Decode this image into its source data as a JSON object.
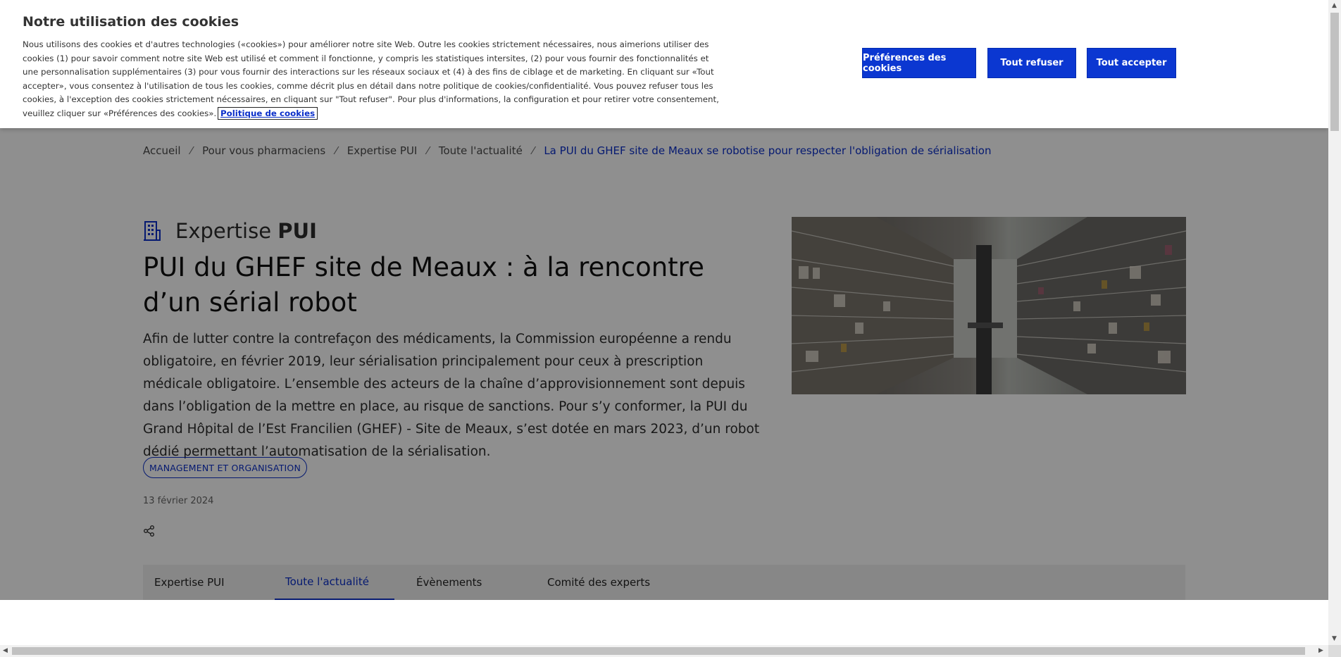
{
  "cookie": {
    "title": "Notre utilisation des cookies",
    "text": "Nous utilisons des cookies et d'autres technologies («cookies») pour améliorer notre site Web. Outre les cookies strictement nécessaires, nous aimerions utiliser des cookies (1) pour savoir comment notre site Web est utilisé et comment il fonctionne, y compris les statistiques intersites, (2) pour vous fournir des fonctionnalités et une personnalisation supplémentaires (3) pour vous fournir des interactions sur les réseaux sociaux et (4) à des fins de ciblage et de marketing. En cliquant sur «Tout accepter», vous consentez à l'utilisation de tous les cookies, comme décrit plus en détail dans notre politique de cookies/confidentialité. Vous pouvez refuser tous les cookies, à l'exception des cookies strictement nécessaires, en cliquant sur \"Tout refuser\". Pour plus d'informations, la configuration et pour retirer votre consentement, veuillez cliquer sur «Préférences des cookies».",
    "link": "Politique de cookies",
    "buttons": {
      "preferences": "Préférences des cookies",
      "refuse": "Tout refuser",
      "accept": "Tout accepter"
    }
  },
  "breadcrumb": {
    "items": [
      "Accueil",
      "Pour vous pharmaciens",
      "Expertise PUI",
      "Toute l'actualité"
    ],
    "current": "La PUI du GHEF site de Meaux se robotise pour respecter l'obligation de sérialisation",
    "separator": "⁄"
  },
  "article": {
    "section_prefix": "Expertise",
    "section_bold": "PUI",
    "section_icon": "building-icon",
    "title": "PUI du GHEF site de Meaux : à la rencontre d’un sérial robot",
    "lead": "Afin de lutter contre la contrefaçon des médicaments, la Commission européenne a rendu obligatoire, en février 2019, leur sérialisation principalement pour ceux à prescription médicale obligatoire. L’ensemble des acteurs de la chaîne d’approvisionnement sont depuis dans l’obligation de la mettre en place, au risque de sanctions. Pour s’y conformer, la PUI du Grand Hôpital de l’Est Francilien (GHEF) - Site de Meaux, s’est dotée en mars 2023, d’un robot dédié permettant l’automatisation de la sérialisation.",
    "tag": "MANAGEMENT ET ORGANISATION",
    "date": "13 février 2024",
    "share_icon": "share-icon"
  },
  "tabs": [
    {
      "label": "Expertise PUI",
      "active": false
    },
    {
      "label": "Toute l'actualité",
      "active": true
    },
    {
      "label": "Évènements",
      "active": false
    },
    {
      "label": "Comité des experts",
      "active": false
    }
  ],
  "colors": {
    "brand_blue": "#0b37d1",
    "link_blue": "#0b2fc9",
    "overlay": "rgba(0,0,0,0.44)"
  }
}
